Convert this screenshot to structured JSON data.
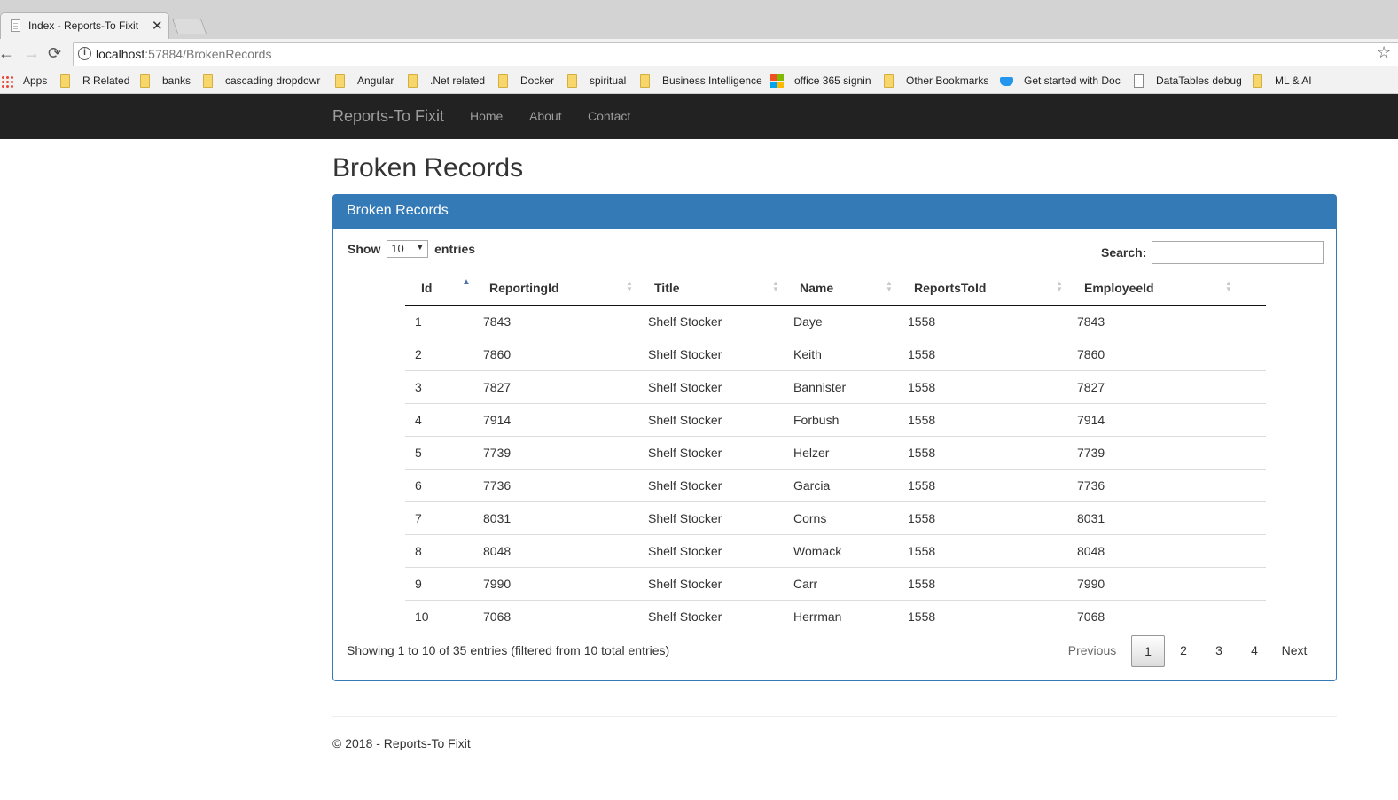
{
  "browser": {
    "tab_title": "Index - Reports-To Fixit",
    "tab_close": "✕",
    "url_host": "localhost",
    "url_path": ":57884/BrokenRecords",
    "nav_back": "←",
    "nav_forward": "→",
    "nav_reload": "⟳",
    "star": "☆",
    "bookmarks": [
      {
        "label": "Apps",
        "icon": "apps-icon"
      },
      {
        "label": "R Related",
        "icon": "folder-icon"
      },
      {
        "label": "banks",
        "icon": "folder-icon"
      },
      {
        "label": "cascading dropdowr",
        "icon": "folder-icon"
      },
      {
        "label": "Angular",
        "icon": "folder-icon"
      },
      {
        "label": ".Net related",
        "icon": "folder-icon"
      },
      {
        "label": "Docker",
        "icon": "folder-icon"
      },
      {
        "label": "spiritual",
        "icon": "folder-icon"
      },
      {
        "label": "Business Intelligence",
        "icon": "folder-icon"
      },
      {
        "label": "office 365 signin",
        "icon": "microsoft-icon"
      },
      {
        "label": "Other Bookmarks",
        "icon": "folder-icon"
      },
      {
        "label": "Get started with Doc",
        "icon": "docker-icon"
      },
      {
        "label": "DataTables debug",
        "icon": "page-icon"
      },
      {
        "label": "ML & AI",
        "icon": "folder-icon"
      }
    ]
  },
  "site_nav": {
    "brand": "Reports-To Fixit",
    "links": [
      "Home",
      "About",
      "Contact"
    ],
    "background": "#222222"
  },
  "page": {
    "title": "Broken Records"
  },
  "panel": {
    "heading": "Broken Records",
    "accent": "#337ab7",
    "length_prefix": "Show",
    "length_value": "10",
    "length_suffix": "entries",
    "search_label": "Search:",
    "search_value": "",
    "columns": [
      "Id",
      "ReportingId",
      "Title",
      "Name",
      "ReportsToId",
      "EmployeeId"
    ],
    "sorted_column": "Id",
    "sort_direction": "ascending",
    "rows": [
      [
        "1",
        "7843",
        "Shelf Stocker",
        "Daye",
        "1558",
        "7843"
      ],
      [
        "2",
        "7860",
        "Shelf Stocker",
        "Keith",
        "1558",
        "7860"
      ],
      [
        "3",
        "7827",
        "Shelf Stocker",
        "Bannister",
        "1558",
        "7827"
      ],
      [
        "4",
        "7914",
        "Shelf Stocker",
        "Forbush",
        "1558",
        "7914"
      ],
      [
        "5",
        "7739",
        "Shelf Stocker",
        "Helzer",
        "1558",
        "7739"
      ],
      [
        "6",
        "7736",
        "Shelf Stocker",
        "Garcia",
        "1558",
        "7736"
      ],
      [
        "7",
        "8031",
        "Shelf Stocker",
        "Corns",
        "1558",
        "8031"
      ],
      [
        "8",
        "8048",
        "Shelf Stocker",
        "Womack",
        "1558",
        "8048"
      ],
      [
        "9",
        "7990",
        "Shelf Stocker",
        "Carr",
        "1558",
        "7990"
      ],
      [
        "10",
        "7068",
        "Shelf Stocker",
        "Herrman",
        "1558",
        "7068"
      ]
    ],
    "info": "Showing 1 to 10 of 35 entries (filtered from 10 total entries)",
    "pagination": {
      "previous": "Previous",
      "pages": [
        "1",
        "2",
        "3",
        "4"
      ],
      "current_page": "1",
      "next": "Next"
    }
  },
  "footer": {
    "text": "© 2018 - Reports-To Fixit"
  }
}
